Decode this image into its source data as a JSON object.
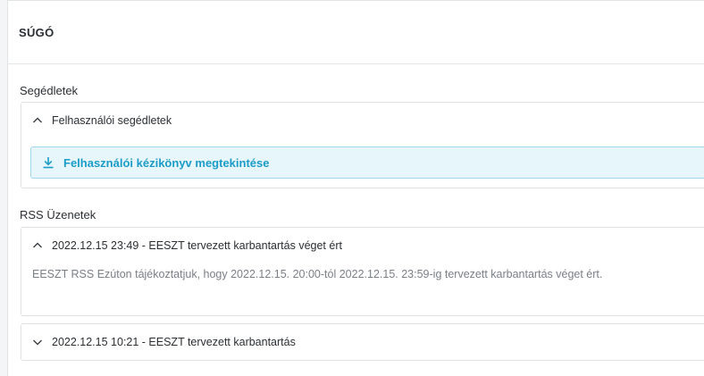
{
  "header": {
    "title": "SÚGÓ"
  },
  "sections": {
    "guides": {
      "title": "Segédletek",
      "card": {
        "title": "Felhasználói segédletek",
        "button_label": "Felhasználói kézikönyv megtekintése"
      }
    },
    "rss": {
      "title": "RSS Üzenetek",
      "items": [
        {
          "title": "2022.12.15 23:49 - EESZT tervezett karbantartás véget ért",
          "body": "EESZT RSS Ezúton tájékoztatjuk, hogy 2022.12.15. 20:00-tól 2022.12.15. 23:59-ig tervezett karbantartás véget ért.",
          "expanded": true
        },
        {
          "title": "2022.12.15 10:21 - EESZT tervezett karbantartás",
          "expanded": false
        }
      ]
    }
  },
  "colors": {
    "accent": "#1b9cc8",
    "accent_bg": "#e7f6fb",
    "border": "#dfe2e5",
    "muted_text": "#7b8087"
  },
  "icons": {
    "collapse": "chevron-up-icon",
    "expand": "chevron-down-icon",
    "download": "download-icon"
  }
}
